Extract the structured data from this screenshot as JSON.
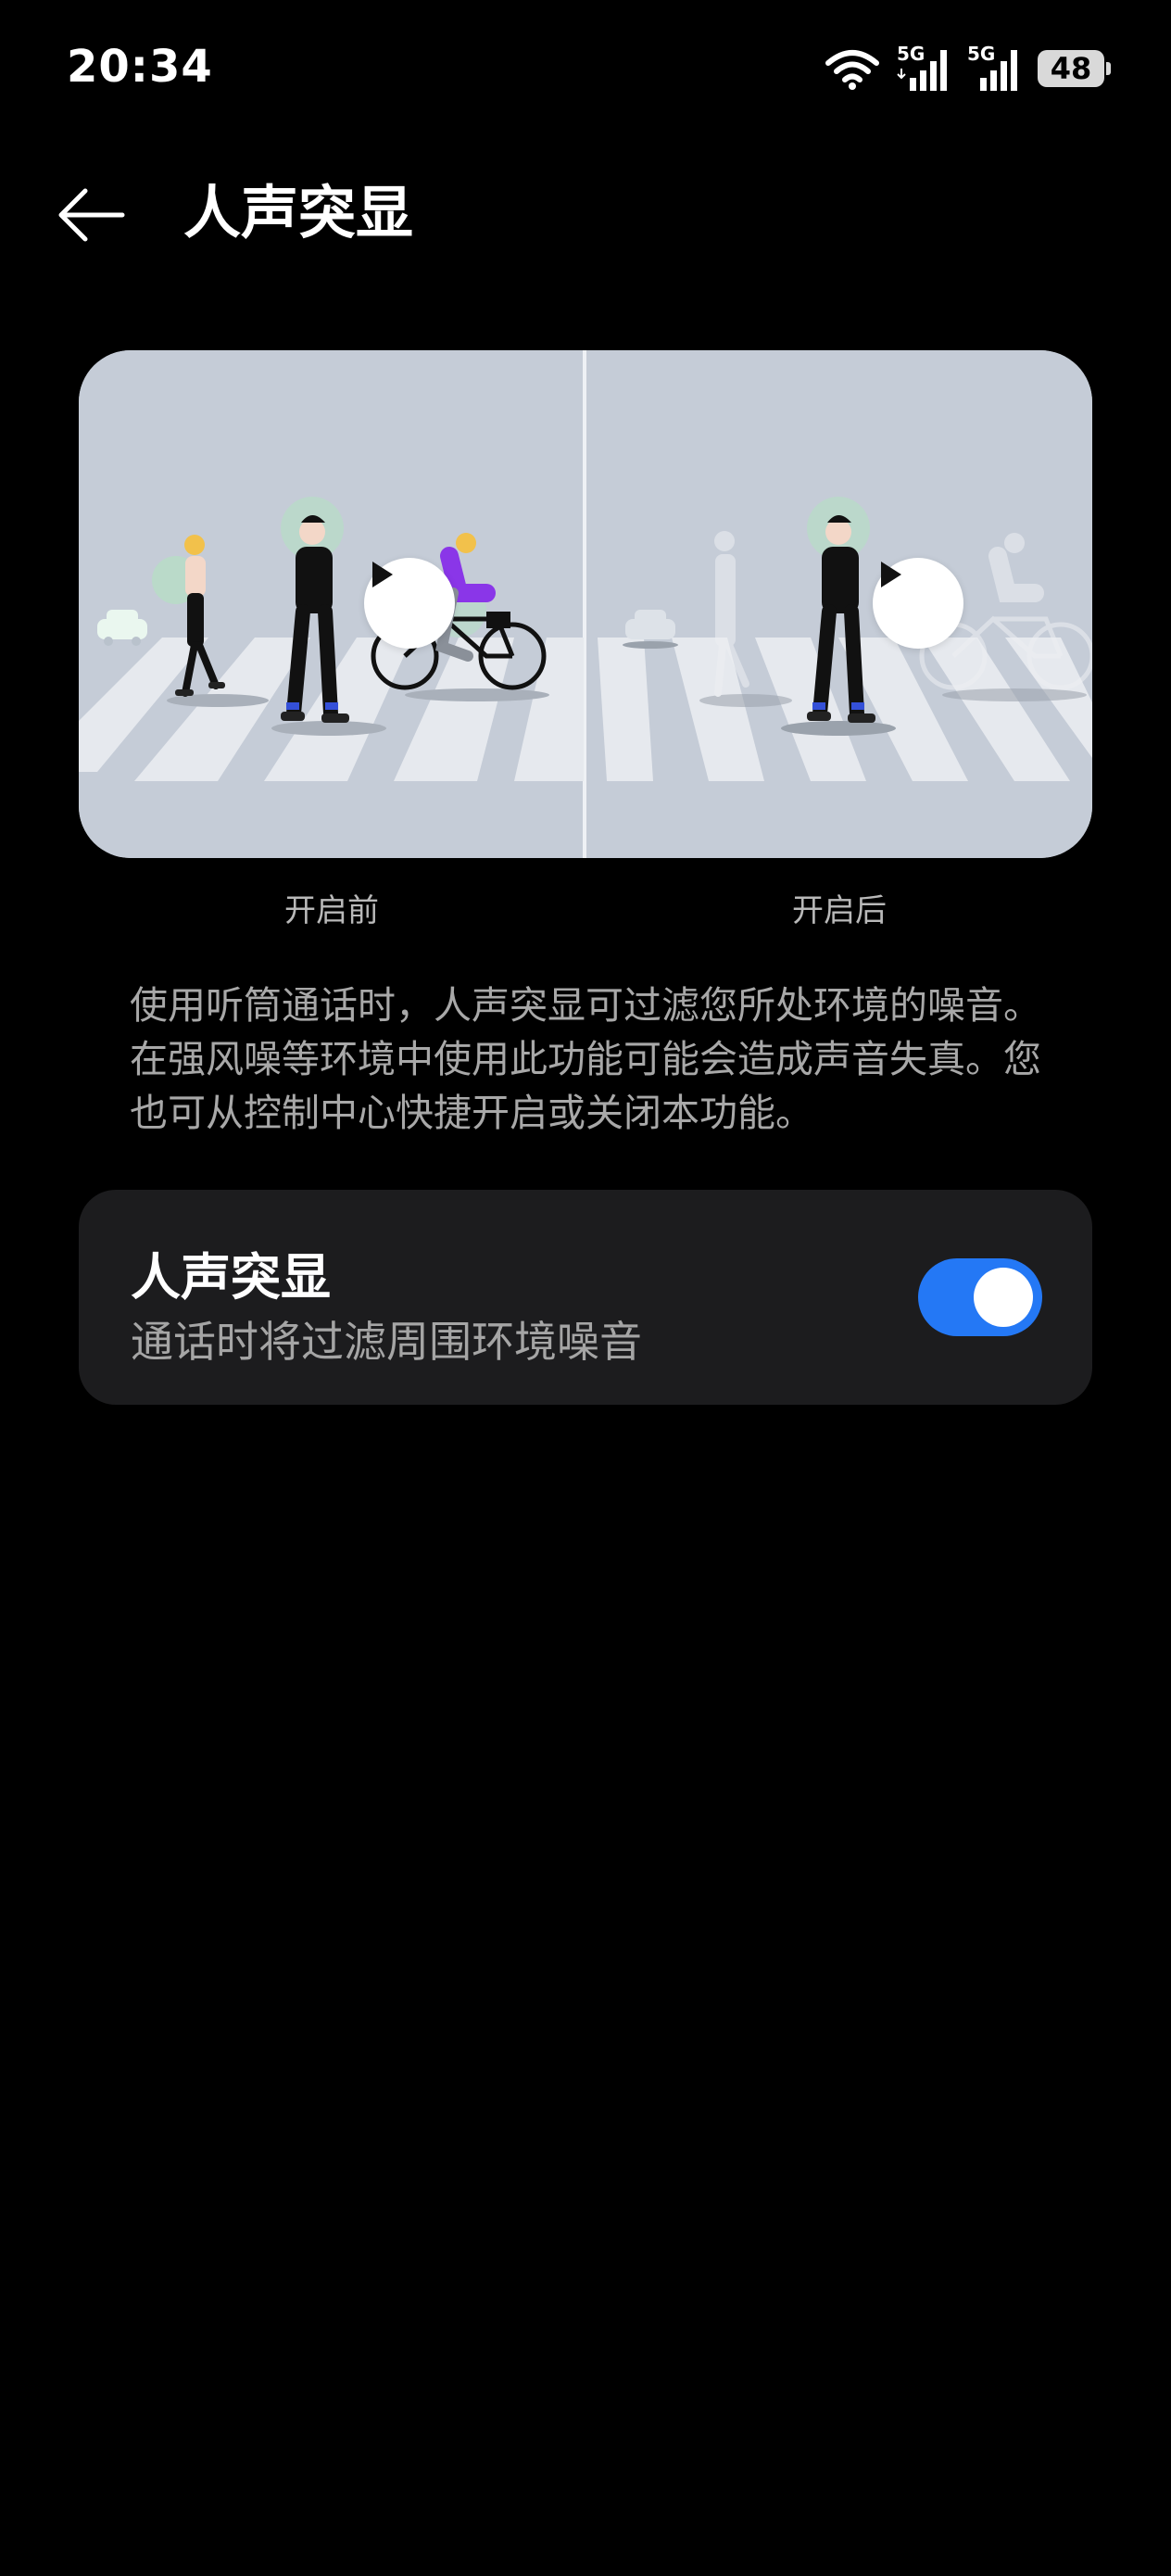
{
  "status_bar": {
    "time": "20:34",
    "sim1_label": "5G",
    "sim2_label": "5G",
    "battery_level": "48"
  },
  "header": {
    "title": "人声突显"
  },
  "illustration": {
    "caption_before": "开启前",
    "caption_after": "开启后"
  },
  "description": "使用听筒通话时，人声突显可过滤您所处环境的噪音。在强风噪等环境中使用此功能可能会造成声音失真。您也可从控制中心快捷开启或关闭本功能。",
  "setting": {
    "title": "人声突显",
    "subtitle": "通话时将过滤周围环境噪音",
    "enabled": true
  },
  "colors": {
    "background": "#000000",
    "card": "#1c1c1e",
    "toggle_on": "#2478f5"
  }
}
